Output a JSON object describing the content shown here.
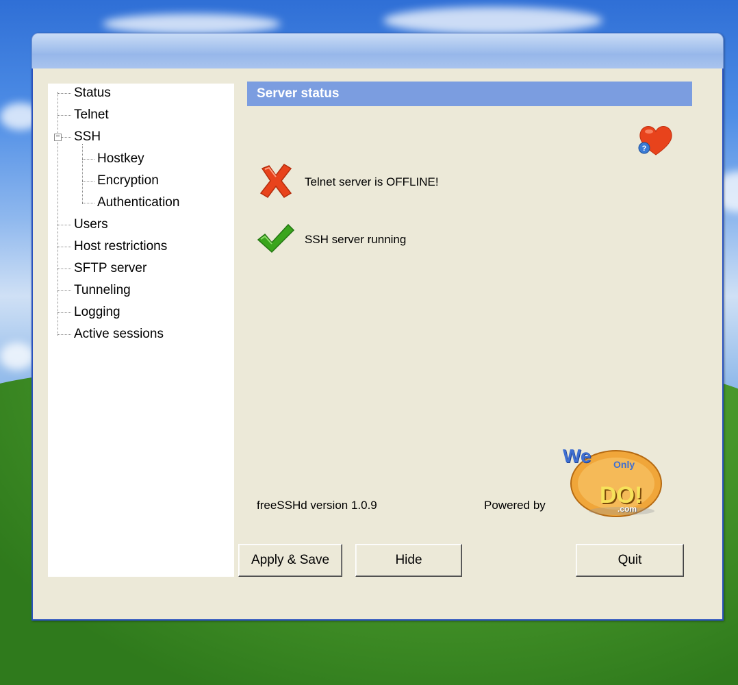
{
  "tree": {
    "items": [
      {
        "label": "Status"
      },
      {
        "label": "Telnet"
      },
      {
        "label": "SSH"
      },
      {
        "label": "Hostkey"
      },
      {
        "label": "Encryption"
      },
      {
        "label": "Authentication"
      },
      {
        "label": "Users"
      },
      {
        "label": "Host restrictions"
      },
      {
        "label": "SFTP server"
      },
      {
        "label": "Tunneling"
      },
      {
        "label": "Logging"
      },
      {
        "label": "Active sessions"
      }
    ],
    "expander_symbol": "−"
  },
  "main": {
    "header": "Server status",
    "telnet_status": "Telnet server is OFFLINE!",
    "ssh_status": "SSH server running",
    "version": "freeSSHd version 1.0.9",
    "powered_by": "Powered by",
    "logo_text": [
      "We",
      "Only",
      "DO!",
      ".com"
    ]
  },
  "buttons": {
    "apply": "Apply & Save",
    "hide": "Hide",
    "quit": "Quit"
  },
  "icons": {
    "offline": "red-x-icon",
    "online": "green-check-icon",
    "help": "heart-help-icon"
  },
  "colors": {
    "header_bg": "#7b9de0",
    "window_bg": "#ece9d8",
    "error_red": "#e8431c",
    "ok_green": "#3aa51d"
  }
}
